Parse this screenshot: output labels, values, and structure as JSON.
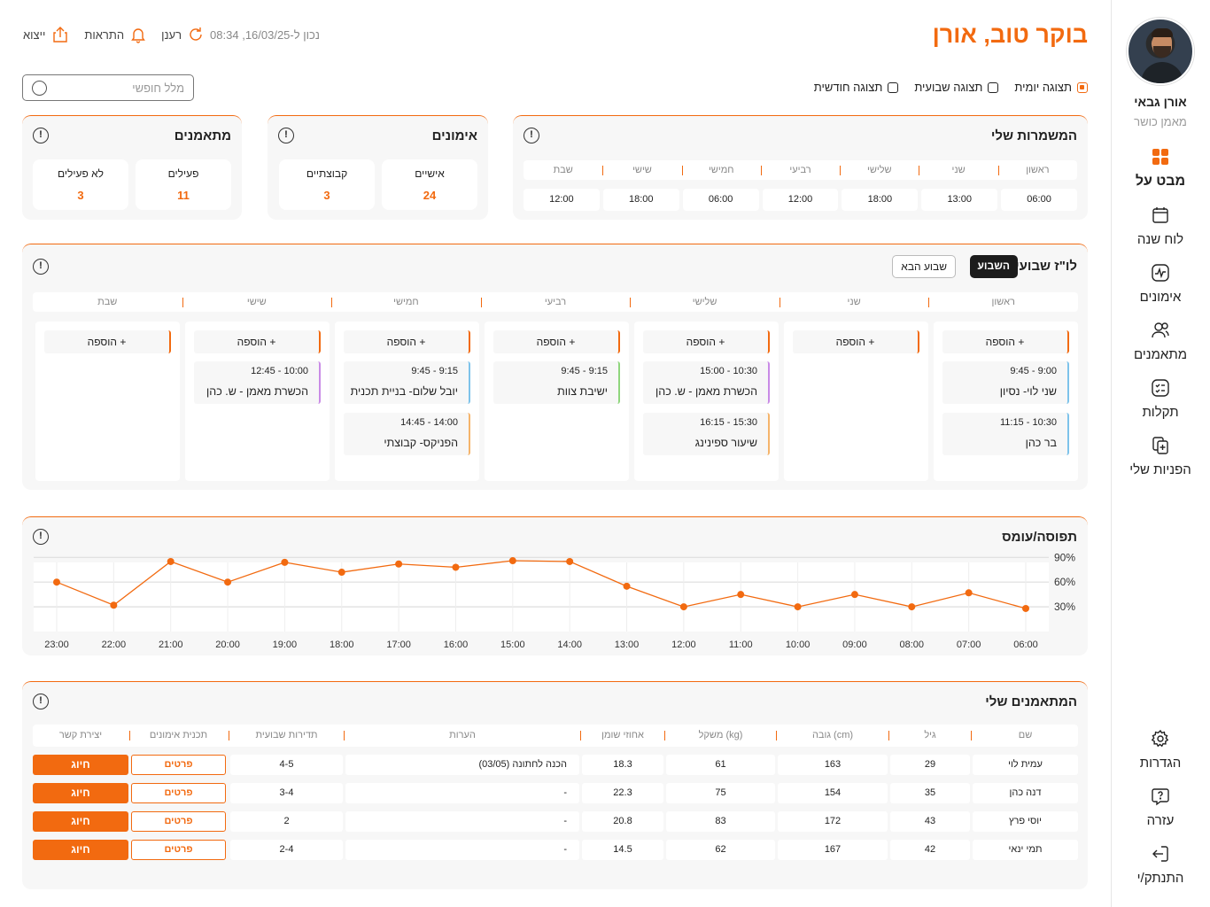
{
  "user": {
    "name": "אורן גבאי",
    "role": "מאמן כושר"
  },
  "nav": [
    {
      "label": "מבט על",
      "icon": "dashboard-icon",
      "active": true
    },
    {
      "label": "לוח שנה",
      "icon": "calendar-icon"
    },
    {
      "label": "אימונים",
      "icon": "activity-icon"
    },
    {
      "label": "מתאמנים",
      "icon": "users-icon"
    },
    {
      "label": "תקלות",
      "icon": "checklist-icon"
    },
    {
      "label": "הפניות שלי",
      "icon": "referrals-icon"
    }
  ],
  "nav_bottom": [
    {
      "label": "הגדרות",
      "icon": "gear-icon"
    },
    {
      "label": "עזרה",
      "icon": "help-icon"
    },
    {
      "label": "התנתק/י",
      "icon": "logout-icon"
    }
  ],
  "header": {
    "greeting": "בוקר טוב, אורן",
    "updated": "נכון ל-16/03/25, 08:34",
    "refresh": "רענן",
    "alerts": "התראות",
    "export": "ייצוא"
  },
  "views": {
    "daily": "תצוגה יומית",
    "weekly": "תצוגה שבועית",
    "monthly": "תצוגה חודשית",
    "selected": "daily"
  },
  "search": {
    "placeholder": "מלל חופשי"
  },
  "shifts": {
    "title": "המשמרות שלי",
    "days": [
      "ראשון",
      "שני",
      "שלישי",
      "רביעי",
      "חמישי",
      "שישי",
      "שבת"
    ],
    "times": [
      "06:00",
      "13:00",
      "18:00",
      "12:00",
      "06:00",
      "18:00",
      "12:00"
    ]
  },
  "workouts": {
    "title": "אימונים",
    "personal_label": "אישיים",
    "personal_value": "24",
    "group_label": "קבוצתיים",
    "group_value": "3"
  },
  "trainees": {
    "title": "מתאמנים",
    "active_label": "פעילים",
    "active_value": "11",
    "inactive_label": "לא פעילים",
    "inactive_value": "3"
  },
  "schedule": {
    "title": "לו\"ז שבועי",
    "this_week": "השבוע",
    "next_week": "שבוע הבא",
    "add_label": "+ הוספה",
    "days": [
      "ראשון",
      "שני",
      "שלישי",
      "רביעי",
      "חמישי",
      "שישי",
      "שבת"
    ],
    "events": [
      [
        {
          "time": "9:00 - 9:45",
          "name": "שני לוי- נסיון",
          "color": "#7ec3ea"
        },
        {
          "time": "10:30 - 11:15",
          "name": "בר כהן",
          "color": "#7ec3ea"
        }
      ],
      [],
      [
        {
          "time": "10:30 - 15:00",
          "name": "הכשרת מאמן - ש. כהן",
          "color": "#c98be6"
        },
        {
          "time": "15:30 - 16:15",
          "name": "שיעור ספינינג",
          "color": "#f5b46b"
        }
      ],
      [
        {
          "time": "9:15 - 9:45",
          "name": "ישיבת צוות",
          "color": "#8fd67d"
        }
      ],
      [
        {
          "time": "9:15 - 9:45",
          "name": "יובל שלום- בניית תכנית",
          "color": "#7ec3ea"
        },
        {
          "time": "14:00 - 14:45",
          "name": "הפניקס- קבוצתי",
          "color": "#f5b46b"
        }
      ],
      [
        {
          "time": "10:00 - 12:45",
          "name": "הכשרת מאמן - ש. כהן",
          "color": "#c98be6"
        }
      ],
      []
    ]
  },
  "occupancy": {
    "title": "תפוסה/עומס"
  },
  "chart_data": {
    "type": "line",
    "title": "תפוסה/עומס",
    "x": [
      "06:00",
      "07:00",
      "08:00",
      "09:00",
      "10:00",
      "11:00",
      "12:00",
      "13:00",
      "14:00",
      "15:00",
      "16:00",
      "17:00",
      "18:00",
      "19:00",
      "20:00",
      "21:00",
      "22:00",
      "23:00"
    ],
    "series": [
      {
        "values": [
          28,
          47,
          30,
          45,
          30,
          45,
          30,
          55,
          85,
          86,
          78,
          82,
          72,
          84,
          60,
          85,
          32,
          60
        ]
      }
    ],
    "yticks": [
      "30%",
      "60%",
      "90%"
    ],
    "ylim": [
      0,
      100
    ],
    "grid": true,
    "color": "#f26a10"
  },
  "my_trainees": {
    "title": "המתאמנים שלי",
    "columns": [
      "שם",
      "גיל",
      "גובה (cm)",
      "משקל (kg)",
      "אחוזי שומן",
      "הערות",
      "תדירות שבועית",
      "תכנית אימונים",
      "יצירת קשר"
    ],
    "details_label": "פרטים",
    "call_label": "חיוג",
    "rows": [
      {
        "name": "עמית לוי",
        "age": "29",
        "height": "163",
        "weight": "61",
        "fat": "18.3",
        "notes": "הכנה לחתונה (03/05)",
        "freq": "4-5"
      },
      {
        "name": "דנה כהן",
        "age": "35",
        "height": "154",
        "weight": "75",
        "fat": "22.3",
        "notes": "-",
        "freq": "3-4"
      },
      {
        "name": "יוסי פרץ",
        "age": "43",
        "height": "172",
        "weight": "83",
        "fat": "20.8",
        "notes": "-",
        "freq": "2"
      },
      {
        "name": "תמי ינאי",
        "age": "42",
        "height": "167",
        "weight": "62",
        "fat": "14.5",
        "notes": "-",
        "freq": "2-4"
      }
    ]
  }
}
